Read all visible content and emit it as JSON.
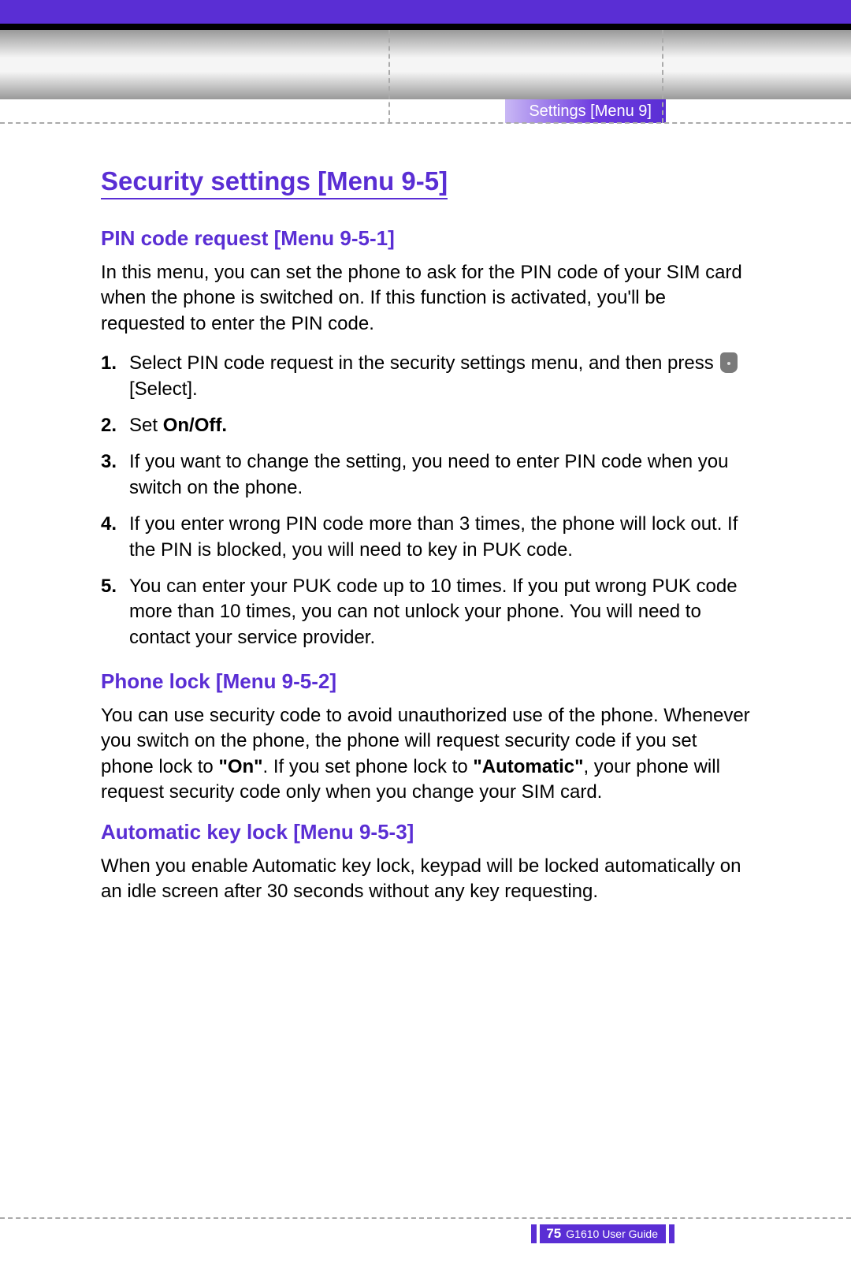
{
  "header": {
    "breadcrumb": "Settings [Menu 9]"
  },
  "section": {
    "title": "Security settings [Menu 9-5]",
    "pin": {
      "heading": "PIN code request [Menu 9-5-1]",
      "intro": "In this menu, you can set the phone to ask for the PIN code of your SIM card when the phone is switched on. If this function is activated, you'll be requested to enter the PIN code.",
      "step1_a": "Select PIN code request in the security settings menu, and then press ",
      "step1_b": " [Select].",
      "step2_a": "Set ",
      "step2_b": "On/Off.",
      "step3": "If you want to change the setting, you need to enter PIN code when you switch on the phone.",
      "step4": "If you enter wrong PIN code more than 3 times, the phone will lock out. If the PIN is blocked, you will need to key in PUK code.",
      "step5": "You can enter your PUK code up to 10 times. If you put wrong PUK code more than 10 times, you can not unlock your phone. You will need to contact your service provider."
    },
    "phonelock": {
      "heading": "Phone lock [Menu 9-5-2]",
      "body_a": "You can use security code to avoid unauthorized use of the phone. Whenever you switch on the phone, the phone will request security code if you set phone lock to ",
      "body_on": "\"On\"",
      "body_b": ". If you set phone lock to ",
      "body_auto": "\"Automatic\"",
      "body_c": ", your phone will request security code only when you change your SIM card."
    },
    "autokey": {
      "heading": "Automatic key lock [Menu 9-5-3]",
      "body": "When you enable Automatic key lock, keypad will be locked automatically on an idle screen after 30 seconds without any key requesting."
    }
  },
  "footer": {
    "page": "75",
    "guide": "G1610 User Guide"
  }
}
